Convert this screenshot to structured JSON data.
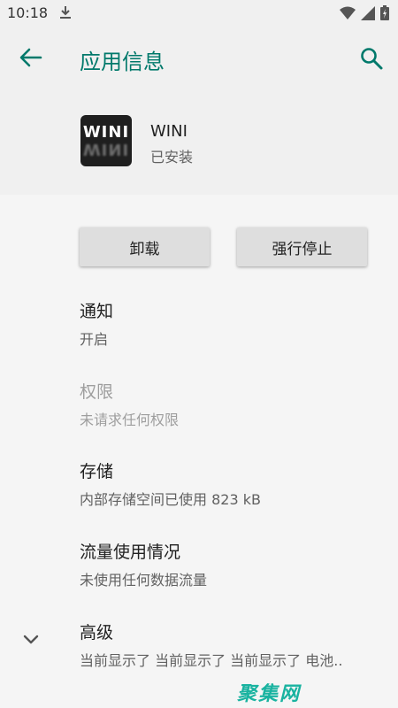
{
  "status_bar": {
    "time": "10:18"
  },
  "app_bar": {
    "title": "应用信息"
  },
  "app": {
    "name": "WINI",
    "status": "已安装",
    "icon_text": "WINI"
  },
  "buttons": {
    "uninstall": "卸载",
    "force_stop": "强行停止"
  },
  "items": [
    {
      "title": "通知",
      "subtitle": "开启",
      "enabled": true
    },
    {
      "title": "权限",
      "subtitle": "未请求任何权限",
      "enabled": false
    },
    {
      "title": "存储",
      "subtitle": "内部存储空间已使用 823 kB",
      "enabled": true
    },
    {
      "title": "流量使用情况",
      "subtitle": "未使用任何数据流量",
      "enabled": true
    },
    {
      "title": "高级",
      "subtitle": "当前显示了 当前显示了 当前显示了 电池..",
      "enabled": true
    }
  ],
  "watermark": "聚集网",
  "colors": {
    "accent": "#00796b",
    "button_bg": "#dedede",
    "background": "#f5f5f5"
  }
}
